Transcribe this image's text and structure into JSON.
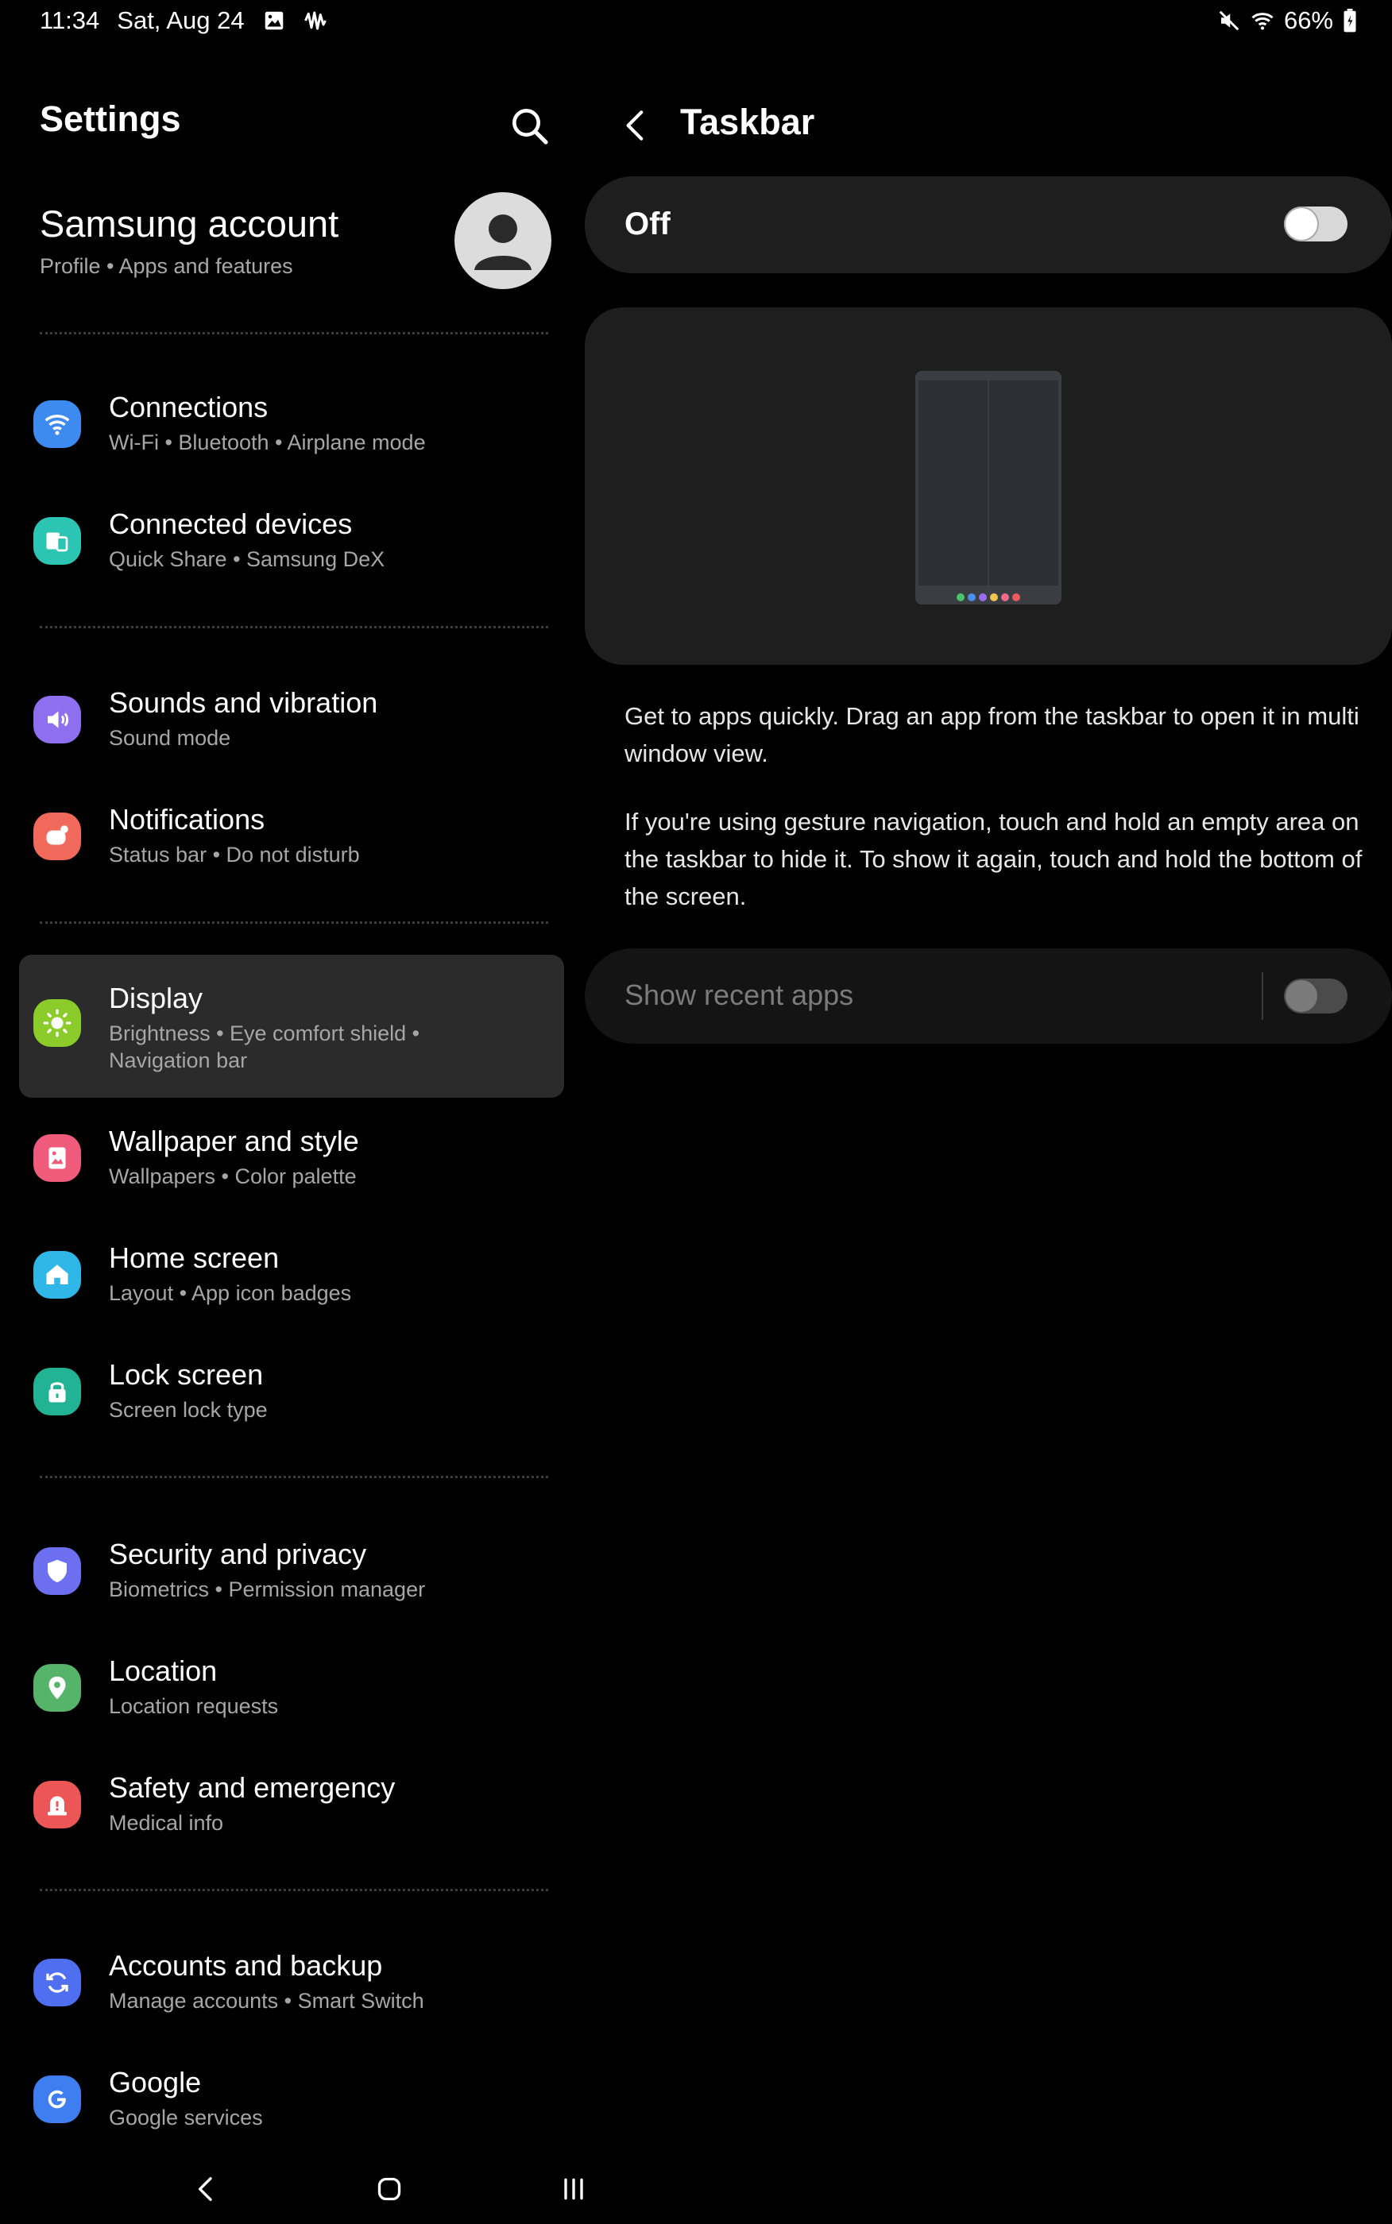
{
  "status_bar": {
    "time": "11:34",
    "date": "Sat, Aug 24",
    "battery": "66%"
  },
  "left_pane": {
    "title": "Settings",
    "account": {
      "title": "Samsung account",
      "subtitle": "Profile  •  Apps and features"
    },
    "items": [
      {
        "title": "Connections",
        "subtitle": "Wi-Fi  •  Bluetooth  •  Airplane mode",
        "icon": "wifi-icon",
        "color": "#3d8bf0"
      },
      {
        "title": "Connected devices",
        "subtitle": "Quick Share  •  Samsung DeX",
        "icon": "devices-icon",
        "color": "#2cc4b2"
      },
      {
        "title": "Sounds and vibration",
        "subtitle": "Sound mode",
        "icon": "volume-icon",
        "color": "#8d6ff0"
      },
      {
        "title": "Notifications",
        "subtitle": "Status bar  •  Do not disturb",
        "icon": "notification-icon",
        "color": "#f0695a"
      },
      {
        "title": "Display",
        "subtitle": "Brightness  •  Eye comfort shield  •  Navigation bar",
        "icon": "sun-icon",
        "color": "#8ccc2a"
      },
      {
        "title": "Wallpaper and style",
        "subtitle": "Wallpapers  •  Color palette",
        "icon": "wallpaper-icon",
        "color": "#ef5b7a"
      },
      {
        "title": "Home screen",
        "subtitle": "Layout  •  App icon badges",
        "icon": "home-icon",
        "color": "#2fb7e8"
      },
      {
        "title": "Lock screen",
        "subtitle": "Screen lock type",
        "icon": "lock-icon",
        "color": "#22b394"
      },
      {
        "title": "Security and privacy",
        "subtitle": "Biometrics  •  Permission manager",
        "icon": "shield-icon",
        "color": "#6b6ff0"
      },
      {
        "title": "Location",
        "subtitle": "Location requests",
        "icon": "location-pin-icon",
        "color": "#55b36a"
      },
      {
        "title": "Safety and emergency",
        "subtitle": "Medical info",
        "icon": "siren-icon",
        "color": "#ec5656"
      },
      {
        "title": "Accounts and backup",
        "subtitle": "Manage accounts  •  Smart Switch",
        "icon": "sync-icon",
        "color": "#4f6ff0"
      },
      {
        "title": "Google",
        "subtitle": "Google services",
        "icon": "google-icon",
        "color": "#3f7ef0"
      }
    ]
  },
  "right_pane": {
    "title": "Taskbar",
    "master_switch_label": "Off",
    "master_switch_on": false,
    "description_1": "Get to apps quickly. Drag an app from the taskbar to open it in multi window view.",
    "description_2": "If you're using gesture navigation, touch and hold an empty area on the taskbar to hide it. To show it again, touch and hold the bottom of the screen.",
    "recent_apps_label": "Show recent apps",
    "recent_apps_on": false,
    "preview_dot_colors": [
      "#48c26a",
      "#4a8ef0",
      "#9a6df0",
      "#f0c64a",
      "#ef6a8a",
      "#ef5a5a"
    ]
  },
  "nav_bar": {
    "back": "back-icon",
    "home": "home-circle-icon",
    "recents": "recents-icon"
  }
}
